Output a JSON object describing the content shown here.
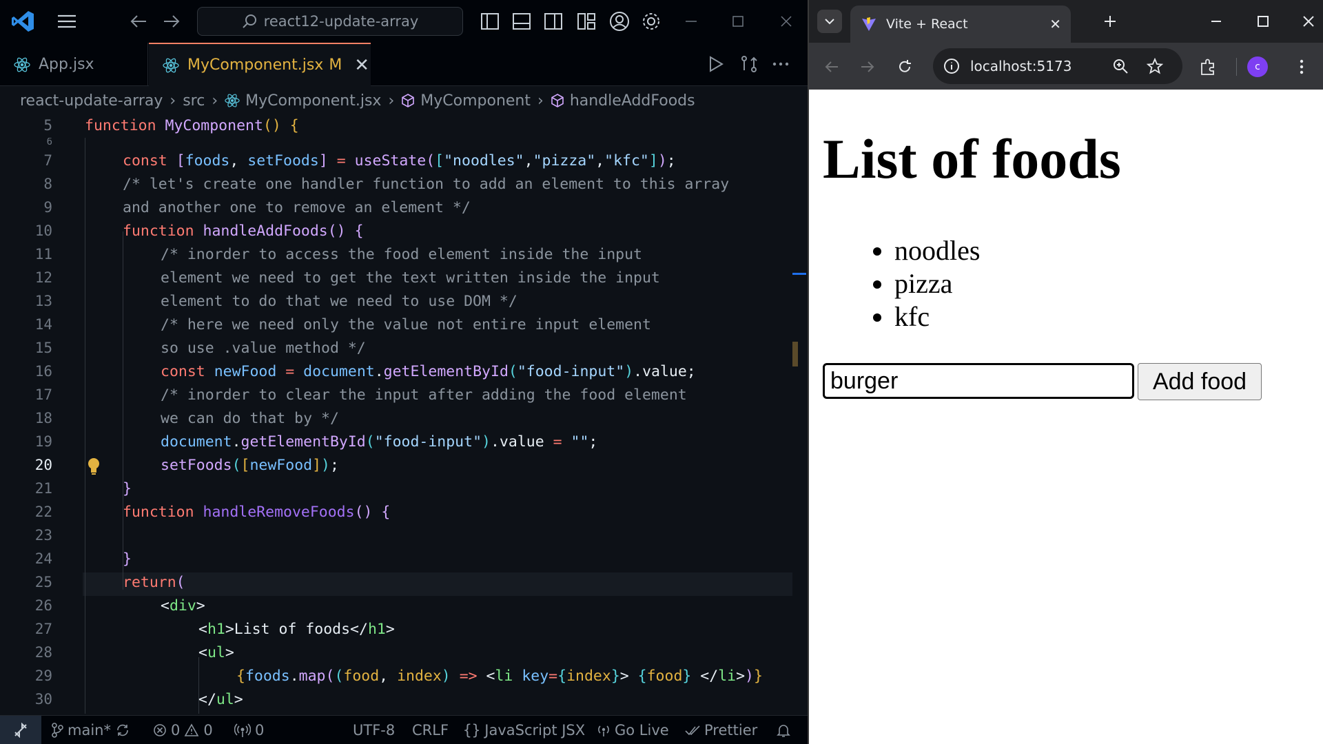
{
  "vscode": {
    "search_text": "react12-update-array",
    "tabs": [
      {
        "label": "App.jsx"
      },
      {
        "label": "MyComponent.jsx",
        "modified": "M"
      }
    ],
    "breadcrumb": [
      "react-update-array",
      "src",
      "MyComponent.jsx",
      "MyComponent",
      "handleAddFoods"
    ],
    "line_numbers": [
      "5",
      "6",
      "7",
      "8",
      "9",
      "10",
      "11",
      "12",
      "13",
      "14",
      "15",
      "16",
      "17",
      "18",
      "19",
      "20",
      "21",
      "22",
      "23",
      "24",
      "25",
      "26",
      "27",
      "28",
      "29",
      "30"
    ],
    "current_line": "20",
    "status": {
      "branch": "main*",
      "errors": "0",
      "warnings": "0",
      "ports": "0",
      "encoding": "UTF-8",
      "eol": "CRLF",
      "language": "JavaScript JSX",
      "go_live": "Go Live",
      "prettier": "Prettier"
    },
    "colors": {
      "accent": "#f78166",
      "keyword": "#ff7b72",
      "function": "#d2a8ff",
      "string": "#a5d6ff",
      "comment": "#8b949e"
    }
  },
  "chrome": {
    "tab_title": "Vite + React",
    "url": "localhost:5173",
    "profile_initial": "c",
    "page": {
      "heading": "List of foods",
      "items": [
        "noodles",
        "pizza",
        "kfc"
      ],
      "input_value": "burger",
      "button_label": "Add food"
    }
  }
}
